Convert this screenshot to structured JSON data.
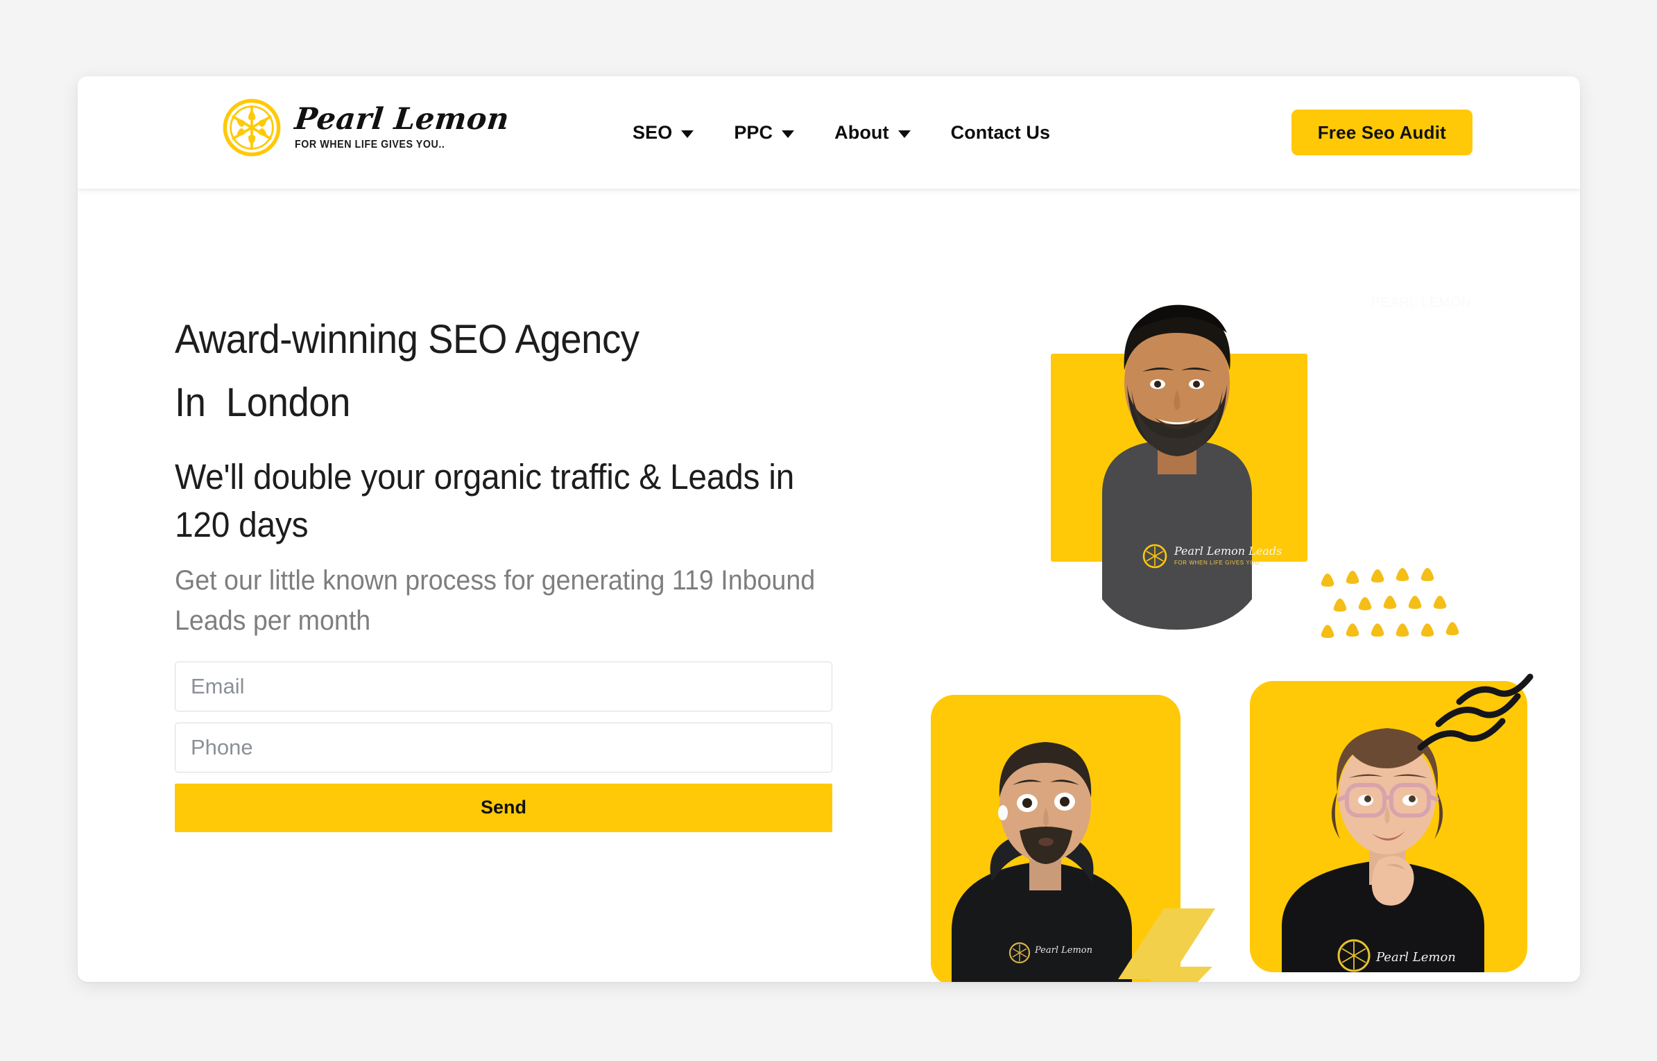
{
  "theme": {
    "brand_yellow": "#FFC907",
    "page_background": "#f4f4f4",
    "card_background": "#ffffff",
    "text_dark": "#1d1d1d",
    "text_muted": "#7e7e7e"
  },
  "header": {
    "brand": {
      "name": "Pearl Lemon",
      "tagline": "FOR WHEN LIFE GIVES YOU..",
      "logo_icon": "lemon-slice-icon"
    },
    "nav": [
      {
        "label": "SEO",
        "has_dropdown": true
      },
      {
        "label": "PPC",
        "has_dropdown": true
      },
      {
        "label": "About",
        "has_dropdown": true
      },
      {
        "label": "Contact Us",
        "has_dropdown": false
      }
    ],
    "cta": {
      "label": "Free Seo Audit"
    }
  },
  "hero": {
    "headline_line1": "Award-winning SEO Agency",
    "headline_line2": "In  London",
    "subheadline": "We'll double your organic traffic & Leads in 120 days",
    "lede": "Get our little known process for generating 119  Inbound  Leads per month",
    "form": {
      "email_placeholder": "Email",
      "email_value": "",
      "phone_placeholder": "Phone",
      "phone_value": "",
      "submit_label": "Send"
    },
    "art": {
      "watermark": "PEARL LEMON",
      "photos": [
        {
          "id": "portrait-top",
          "alt": "Smiling bearded man in dark grey Pearl Lemon Leads t-shirt",
          "backdrop": "yellow-square",
          "shirt_text": "Pearl Lemon Leads"
        },
        {
          "id": "portrait-bottom-left",
          "alt": "Surprised man with earbuds wearing a black Pearl Lemon hoodie",
          "backdrop": "yellow-rounded-square",
          "decoration": "lightning-bolt-icon"
        },
        {
          "id": "portrait-bottom-right",
          "alt": "Woman with pink glasses resting hand on chin in black Pearl Lemon t-shirt",
          "backdrop": "yellow-rounded-square",
          "decoration": "squiggle-lines-icon"
        }
      ],
      "decorations": [
        {
          "name": "yellow-dot-cluster-icon",
          "rows": 3,
          "count": 16
        },
        {
          "name": "lightning-bolt-icon"
        },
        {
          "name": "squiggle-lines-icon"
        }
      ]
    }
  }
}
